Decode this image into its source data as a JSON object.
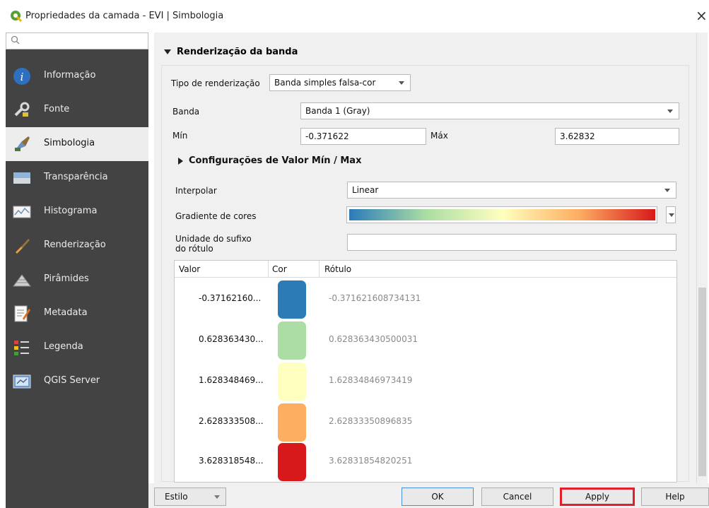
{
  "window": {
    "title": "Propriedades da camada - EVI | Simbologia",
    "close_glyph": "×"
  },
  "sidebar": {
    "search_placeholder": "",
    "items": [
      {
        "label": "Informação",
        "icon": "info-icon",
        "active": false
      },
      {
        "label": "Fonte",
        "icon": "source-wrench-icon",
        "active": false
      },
      {
        "label": "Simbologia",
        "icon": "symbology-brush-icon",
        "active": true
      },
      {
        "label": "Transparência",
        "icon": "transparency-icon",
        "active": false
      },
      {
        "label": "Histograma",
        "icon": "histogram-icon",
        "active": false
      },
      {
        "label": "Renderização",
        "icon": "rendering-brush-icon",
        "active": false
      },
      {
        "label": "Pirâmides",
        "icon": "pyramids-icon",
        "active": false
      },
      {
        "label": "Metadata",
        "icon": "metadata-icon",
        "active": false
      },
      {
        "label": "Legenda",
        "icon": "legend-icon",
        "active": false
      },
      {
        "label": "QGIS Server",
        "icon": "qgis-server-icon",
        "active": false
      }
    ]
  },
  "band_rendering": {
    "section_title": "Renderização da banda",
    "render_type_label": "Tipo de renderização",
    "render_type_value": "Banda simples falsa-cor",
    "band_label": "Banda",
    "band_value": "Banda 1 (Gray)",
    "min_label": "Mín",
    "min_value": "-0.371622",
    "max_label": "Máx",
    "max_value": "3.62832",
    "minmax_section": "Configurações de Valor Mín / Max",
    "interpolate_label": "Interpolar",
    "interpolate_value": "Linear",
    "gradient_label": "Gradiente de cores",
    "suffix_label_1": "Unidade do sufixo",
    "suffix_label_2": "do rótulo",
    "suffix_value": ""
  },
  "table": {
    "headers": [
      "Valor",
      "Cor",
      "Rótulo"
    ],
    "rows": [
      {
        "value": "-0.37162160...",
        "color": "#2c7bb6",
        "label": "-0.371621608734131"
      },
      {
        "value": "0.628363430...",
        "color": "#abdda4",
        "label": "0.628363430500031"
      },
      {
        "value": "1.628348469...",
        "color": "#ffffbf",
        "label": "1.62834846973419"
      },
      {
        "value": "2.628333508...",
        "color": "#fdae61",
        "label": "2.62833350896835"
      },
      {
        "value": "3.628318548...",
        "color": "#d7191c",
        "label": "3.62831854820251"
      }
    ]
  },
  "buttons": {
    "style": "Estilo",
    "ok": "OK",
    "cancel": "Cancel",
    "apply": "Apply",
    "help": "Help"
  },
  "colors": {
    "sidebar_bg": "#434343",
    "highlight": "#e0202a",
    "qgis_green": "#5a9e3a"
  }
}
